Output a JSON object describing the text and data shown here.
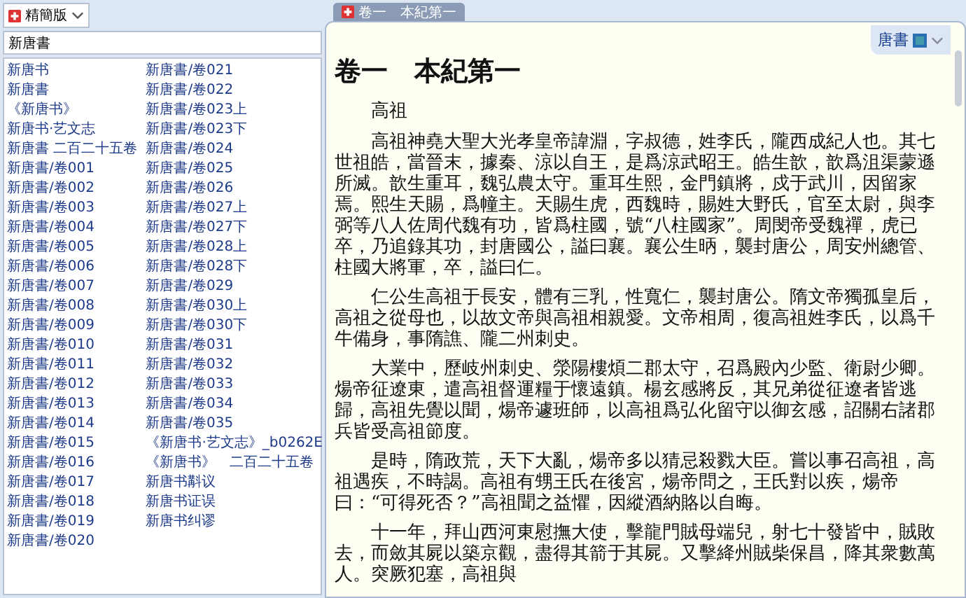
{
  "edition_select": {
    "label": "精簡版"
  },
  "search": {
    "value": "新唐書"
  },
  "sidebar": {
    "items": [
      "新唐书",
      "新唐書",
      "《新唐书》",
      "新唐书·艺文志",
      "新唐書 二百二十五卷",
      "新唐書/卷001",
      "新唐書/卷002",
      "新唐書/卷003",
      "新唐書/卷004",
      "新唐書/卷005",
      "新唐書/卷006",
      "新唐書/卷007",
      "新唐書/卷008",
      "新唐書/卷009",
      "新唐書/卷010",
      "新唐書/卷011",
      "新唐書/卷012",
      "新唐書/卷013",
      "新唐書/卷014",
      "新唐書/卷015",
      "新唐書/卷016",
      "新唐書/卷017",
      "新唐書/卷018",
      "新唐書/卷019",
      "新唐書/卷020",
      "新唐書/卷021",
      "新唐書/卷022",
      "新唐書/卷023上",
      "新唐書/卷023下",
      "新唐書/卷024",
      "新唐書/卷025",
      "新唐書/卷026",
      "新唐書/卷027上",
      "新唐書/卷027下",
      "新唐書/卷028上",
      "新唐書/卷028下",
      "新唐書/卷029",
      "新唐書/卷030上",
      "新唐書/卷030下",
      "新唐書/卷031",
      "新唐書/卷032",
      "新唐書/卷033",
      "新唐書/卷034",
      "新唐書/卷035",
      "《新唐书·艺文志》_b0262E",
      "《新唐书》　二百二十五卷",
      "新唐书斠议",
      "新唐书证误",
      "新唐书纠谬"
    ]
  },
  "tabs": [
    {
      "label": "卷一　本紀第一",
      "selected": true
    }
  ],
  "book_switcher": {
    "label": "唐書"
  },
  "document": {
    "title": "卷一　本紀第一",
    "subtitle": "高祖",
    "paragraphs": [
      "高祖神堯大聖大光孝皇帝諱淵，字叔德，姓李氏，隴西成紀人也。其七世祖皓，當晉末，據秦、涼以自王，是爲涼武昭王。皓生歆，歆爲沮渠蒙遜所滅。歆生重耳，魏弘農太守。重耳生熙，金門鎮將，戍于武川，因留家焉。熙生天賜，爲幢主。天賜生虎，西魏時，賜姓大野氏，官至太尉，與李弼等八人佐周代魏有功，皆爲柱國，號“八柱國家”。周閔帝受魏禪，虎已卒，乃追錄其功，封唐國公，謚曰襄。襄公生昞，襲封唐公，周安州總管、柱國大將軍，卒，謚曰仁。",
      "仁公生高祖于長安，體有三乳，性寬仁，襲封唐公。隋文帝獨孤皇后，高祖之從母也，以故文帝與高祖相親愛。文帝相周，復高祖姓李氏，以爲千牛備身，事隋譙、隴二州刺史。",
      "大業中，歷岐州刺史、滎陽樓煩二郡太守，召爲殿內少監、衛尉少卿。煬帝征遼東，遣高祖督運糧于懷遠鎮。楊玄感將反，其兄弟從征遼者皆逃歸，高祖先覺以聞，煬帝遽班師，以高祖爲弘化留守以御玄感，詔關右諸郡兵皆受高祖節度。",
      "是時，隋政荒，天下大亂，煬帝多以猜忌殺戮大臣。嘗以事召高祖，高祖遇疾，不時謁。高祖有甥王氏在後宮，煬帝問之，王氏對以疾，煬帝曰：“可得死否？”高祖聞之益懼，因縱酒納賂以自晦。",
      "十一年，拜山西河東慰撫大使，擊龍門賊母端兒，射七十發皆中，賊敗去，而斂其屍以築京觀，盡得其箭于其屍。又擊絳州賊柴保昌，降其衆數萬人。突厥犯塞，高祖與"
    ]
  }
}
